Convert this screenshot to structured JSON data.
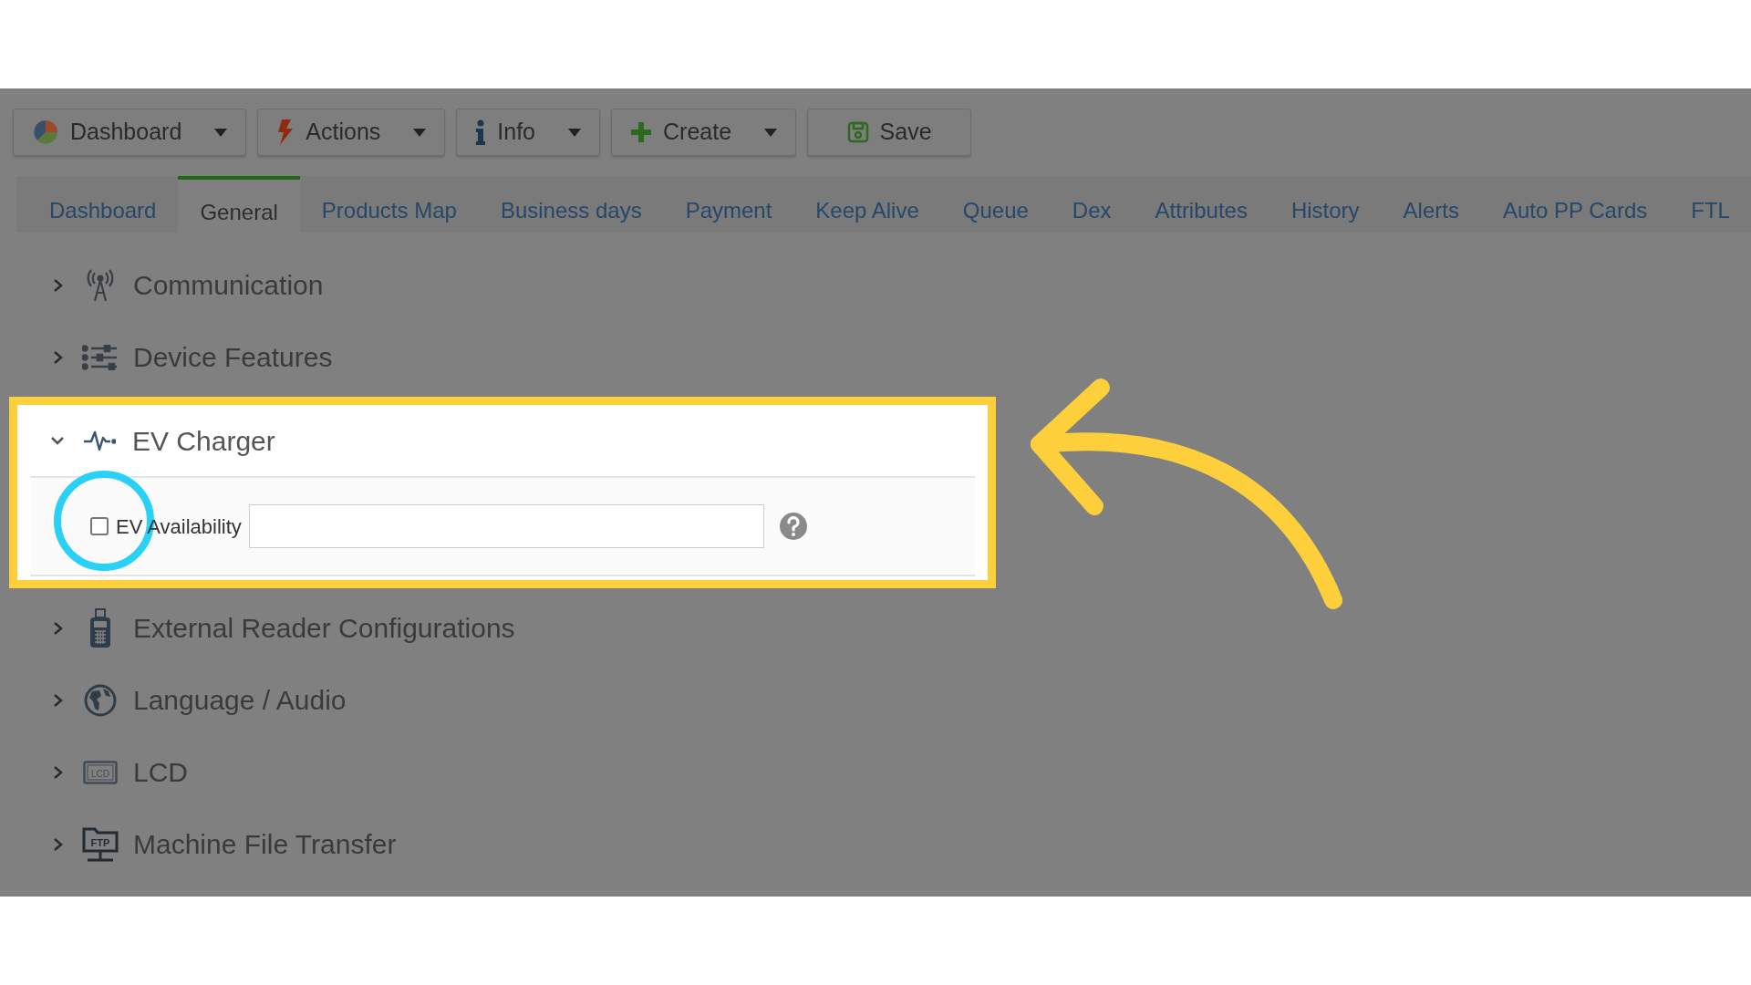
{
  "toolbar": [
    {
      "label": "Dashboard",
      "dropdown": true
    },
    {
      "label": "Actions",
      "dropdown": true
    },
    {
      "label": "Info",
      "dropdown": true
    },
    {
      "label": "Create",
      "dropdown": true
    },
    {
      "label": "Save",
      "dropdown": false
    }
  ],
  "tabs": [
    {
      "label": "Dashboard",
      "selected": false
    },
    {
      "label": "General",
      "selected": true
    },
    {
      "label": "Products Map",
      "selected": false
    },
    {
      "label": "Business days",
      "selected": false
    },
    {
      "label": "Payment",
      "selected": false
    },
    {
      "label": "Keep Alive",
      "selected": false
    },
    {
      "label": "Queue",
      "selected": false
    },
    {
      "label": "Dex",
      "selected": false
    },
    {
      "label": "Attributes",
      "selected": false
    },
    {
      "label": "History",
      "selected": false
    },
    {
      "label": "Alerts",
      "selected": false
    },
    {
      "label": "Auto PP Cards",
      "selected": false
    },
    {
      "label": "FTL",
      "selected": false
    }
  ],
  "sections": [
    {
      "title": "Communication",
      "expanded": false,
      "highlighted": false
    },
    {
      "title": "Device Features",
      "expanded": false,
      "highlighted": false
    },
    {
      "title": "EV Charger",
      "expanded": true,
      "highlighted": true,
      "fields": [
        {
          "kind": "checkbox",
          "label": "EV Availability",
          "checked": false,
          "help": true
        }
      ]
    },
    {
      "title": "External Reader Configurations",
      "expanded": false,
      "highlighted": false
    },
    {
      "title": "Language / Audio",
      "expanded": false,
      "highlighted": false
    },
    {
      "title": "LCD",
      "icon_text": "LCD",
      "expanded": false,
      "highlighted": false
    },
    {
      "title": "Machine File Transfer",
      "icon_text": "FTP",
      "expanded": false,
      "highlighted": false
    }
  ]
}
